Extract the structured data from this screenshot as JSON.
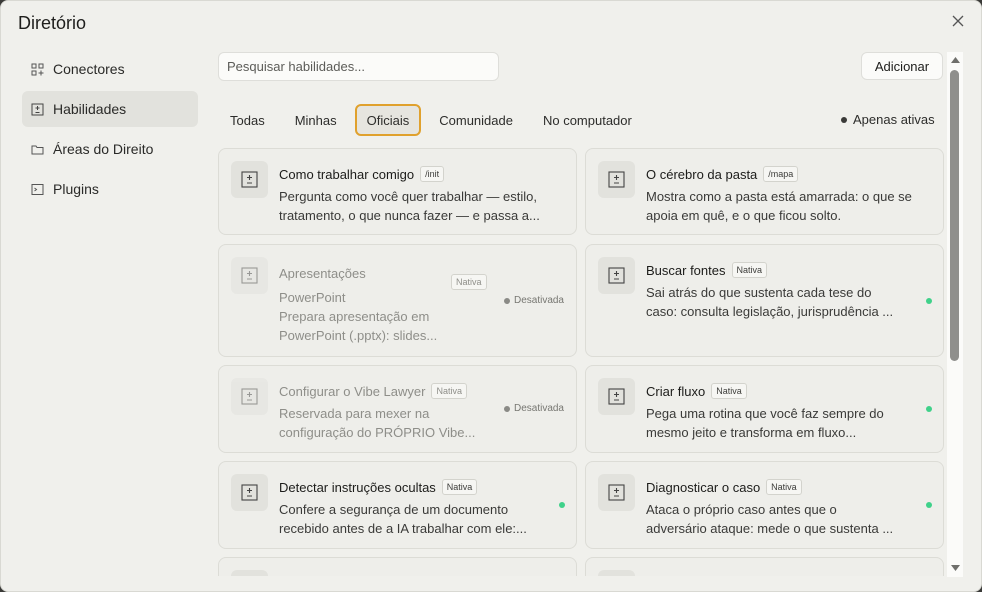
{
  "dialog": {
    "title": "Diretório"
  },
  "sidebar": {
    "items": [
      {
        "label": "Conectores",
        "icon": "grid-plus-icon"
      },
      {
        "label": "Habilidades",
        "icon": "skill-box-icon"
      },
      {
        "label": "Áreas do Direito",
        "icon": "folder-icon"
      },
      {
        "label": "Plugins",
        "icon": "terminal-icon"
      }
    ],
    "active_index": 1
  },
  "search": {
    "placeholder": "Pesquisar habilidades..."
  },
  "actions": {
    "add_label": "Adicionar"
  },
  "tabs": [
    {
      "label": "Todas"
    },
    {
      "label": "Minhas"
    },
    {
      "label": "Oficiais",
      "active": true
    },
    {
      "label": "Comunidade"
    },
    {
      "label": "No computador"
    }
  ],
  "filter": {
    "only_active_label": "Apenas ativas"
  },
  "cards": [
    {
      "name": "Como trabalhar comigo",
      "badge": "/init",
      "desc1": "Pergunta como você quer trabalhar — estilo,",
      "desc2": "tratamento, o que nunca fazer — e passa a...",
      "state": "none"
    },
    {
      "name": "O cérebro da pasta",
      "badge": "/mapa",
      "desc1": "Mostra como a pasta está amarrada: o que se",
      "desc2": "apoia em quê, e o que ficou solto.",
      "state": "none"
    },
    {
      "name1": "Apresentações",
      "name2": "PowerPoint",
      "badge": "Nativa",
      "desc1": "Prepara apresentação em",
      "desc2": "PowerPoint (.pptx): slides...",
      "state": "disabled",
      "status": "Desativada"
    },
    {
      "name": "Buscar fontes",
      "badge": "Nativa",
      "desc1": "Sai atrás do que sustenta cada tese do",
      "desc2": "caso: consulta legislação, jurisprudência ...",
      "state": "active"
    },
    {
      "name": "Configurar o Vibe Lawyer",
      "badge": "Nativa",
      "desc1": "Reservada para mexer na",
      "desc2": "configuração do PRÓPRIO Vibe...",
      "state": "disabled",
      "status": "Desativada"
    },
    {
      "name": "Criar fluxo",
      "badge": "Nativa",
      "desc1": "Pega uma rotina que você faz sempre do",
      "desc2": "mesmo jeito e transforma em fluxo...",
      "state": "active"
    },
    {
      "name": "Detectar instruções ocultas",
      "badge": "Nativa",
      "desc1": "Confere a segurança de um documento",
      "desc2": "recebido antes de a IA trabalhar com ele:...",
      "state": "active"
    },
    {
      "name": "Diagnosticar o caso",
      "badge": "Nativa",
      "desc1": "Ataca o próprio caso antes que o",
      "desc2": "adversário ataque: mede o que sustenta ...",
      "state": "active"
    }
  ],
  "colors": {
    "accent_border": "#e0a12d",
    "active_dot": "#3fd18a"
  }
}
